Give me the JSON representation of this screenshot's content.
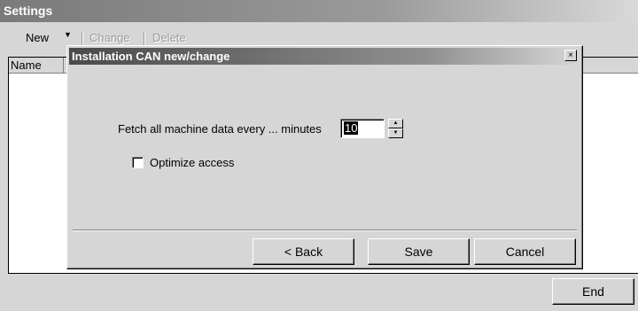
{
  "window": {
    "title": "Settings"
  },
  "toolbar": {
    "new_label": "New",
    "change_label": "Change",
    "delete_label": "Delete"
  },
  "list": {
    "columns": [
      "Name"
    ]
  },
  "footer": {
    "end_label": "End"
  },
  "dialog": {
    "title": "Installation CAN new/change",
    "close_glyph": "×",
    "fetch_label": "Fetch all machine data every ... minutes",
    "fetch_value": "10",
    "optimize_label": "Optimize access",
    "optimize_checked": false,
    "buttons": {
      "back": "< Back",
      "save": "Save",
      "cancel": "Cancel"
    }
  }
}
